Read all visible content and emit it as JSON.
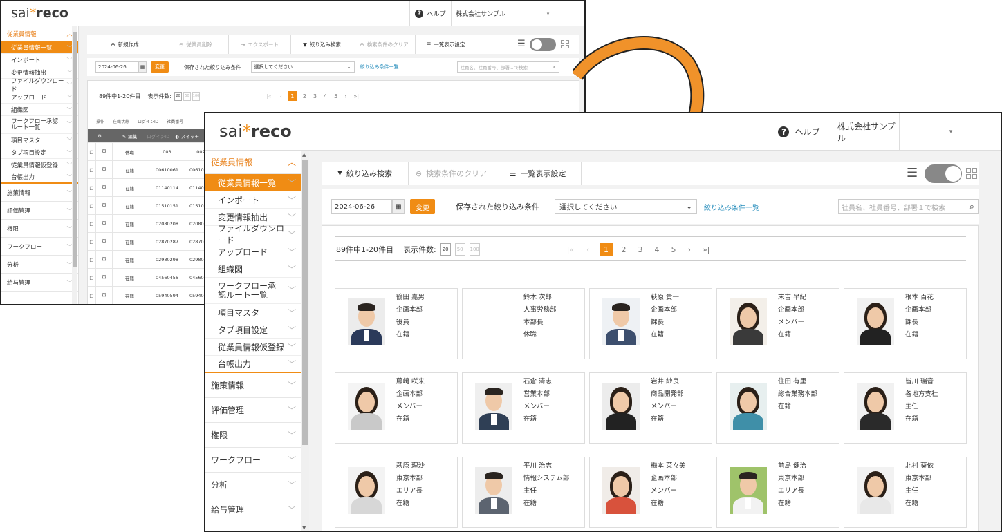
{
  "app": {
    "logo_pre": "sai",
    "logo_star": "*",
    "logo_post": "reco"
  },
  "header": {
    "help": "ヘルプ",
    "company": "株式会社サンプル",
    "user_dropdown": "▾"
  },
  "sidebar": {
    "open_group": "従業員情報",
    "items": [
      "従業員情報一覧",
      "インポート",
      "変更情報抽出",
      "ファイルダウンロード",
      "アップロード",
      "組織図",
      "ワークフロー承認ルート一覧",
      "項目マスタ",
      "タブ項目設定",
      "従業員情報仮登録",
      "台帳出力"
    ],
    "groups": [
      "施策情報",
      "評価管理",
      "権限",
      "ワークフロー",
      "分析",
      "給与管理"
    ]
  },
  "back_toolbar": {
    "new": "新規作成",
    "delete": "従業員削除",
    "export": "エクスポート",
    "filter": "絞り込み検索",
    "clear": "検索条件のクリア",
    "display": "一覧表示設定"
  },
  "front_toolbar": {
    "filter": "絞り込み検索",
    "clear": "検索条件のクリア",
    "display": "一覧表示設定"
  },
  "filter": {
    "date": "2024-06-26",
    "change": "変更",
    "saved_label": "保存された絞り込み条件",
    "select_value": "選択してください",
    "saved_link": "絞り込み条件一覧",
    "search_placeholder": "社員名、社員番号、部署１で検索"
  },
  "pagination": {
    "summary": "89件中1-20件目",
    "size_label": "表示件数:",
    "sizes": [
      "20",
      "50",
      "100"
    ],
    "first": "|«",
    "prev": "‹",
    "pages": [
      "1",
      "2",
      "3",
      "4",
      "5"
    ],
    "next": "›",
    "last": "»|"
  },
  "table": {
    "headers": [
      "操作",
      "在職状態",
      "ログインID",
      "社員番号"
    ],
    "action_edit": "編集",
    "action_switch": "スイッチ",
    "action_col": "ログインID",
    "rows": [
      [
        "休職",
        "003",
        "002"
      ],
      [
        "在籍",
        "00610061",
        "00610061"
      ],
      [
        "在籍",
        "01140114",
        "01140114"
      ],
      [
        "在籍",
        "01510151",
        "01510151"
      ],
      [
        "在籍",
        "02080208",
        "02080208"
      ],
      [
        "在籍",
        "02870287",
        "02870287"
      ],
      [
        "在籍",
        "02980298",
        "02980298"
      ],
      [
        "在籍",
        "04560456",
        "04560456"
      ],
      [
        "在籍",
        "05940594",
        "05940594"
      ]
    ]
  },
  "employees": [
    {
      "name": "鶴田 嘉男",
      "dept": "企画本部",
      "title": "役員",
      "status": "在籍",
      "photo": true,
      "gender": "m",
      "shirt": "#2b3a5a",
      "bg": "#ececec"
    },
    {
      "name": "鈴木 次郎",
      "dept": "人事労務部",
      "title": "本部長",
      "status": "休職",
      "photo": false
    },
    {
      "name": "萩原 貴一",
      "dept": "企画本部",
      "title": "課長",
      "status": "在籍",
      "photo": true,
      "gender": "m",
      "shirt": "#3d4f6e",
      "bg": "#eef1f4"
    },
    {
      "name": "末吉 早紀",
      "dept": "企画本部",
      "title": "メンバー",
      "status": "在籍",
      "photo": true,
      "gender": "f",
      "shirt": "#3a3a3a",
      "bg": "#f3efe9"
    },
    {
      "name": "根本 百花",
      "dept": "企画本部",
      "title": "課長",
      "status": "在籍",
      "photo": true,
      "gender": "f",
      "shirt": "#222222",
      "bg": "#f1f1f1"
    },
    {
      "name": "藤崎 咲来",
      "dept": "企画本部",
      "title": "メンバー",
      "status": "在籍",
      "photo": true,
      "gender": "f",
      "shirt": "#c9c9c9",
      "bg": "#f4f4f4"
    },
    {
      "name": "石倉 清志",
      "dept": "営業本部",
      "title": "メンバー",
      "status": "在籍",
      "photo": true,
      "gender": "m",
      "shirt": "#2f3f55",
      "bg": "#efefef"
    },
    {
      "name": "岩井 紗良",
      "dept": "商品開発部",
      "title": "メンバー",
      "status": "在籍",
      "photo": true,
      "gender": "f",
      "shirt": "#222222",
      "bg": "#ececec"
    },
    {
      "name": "住田 有里",
      "dept": "総合業務本部",
      "title": "在籍",
      "status": "",
      "photo": true,
      "gender": "f",
      "shirt": "#3f8fa8",
      "bg": "#e7efef"
    },
    {
      "name": "皆川 瑞音",
      "dept": "各地方支社",
      "title": "主任",
      "status": "在籍",
      "photo": true,
      "gender": "f",
      "shirt": "#2a2a2a",
      "bg": "#f1f1f1"
    },
    {
      "name": "萩原 理沙",
      "dept": "東京本部",
      "title": "エリア長",
      "status": "在籍",
      "photo": true,
      "gender": "f",
      "shirt": "#d7d7d7",
      "bg": "#f3f3f3"
    },
    {
      "name": "平川 治志",
      "dept": "情報システム部",
      "title": "主任",
      "status": "在籍",
      "photo": true,
      "gender": "m",
      "shirt": "#5c6470",
      "bg": "#ededed"
    },
    {
      "name": "梅本 菜々美",
      "dept": "企画本部",
      "title": "メンバー",
      "status": "在籍",
      "photo": true,
      "gender": "f",
      "shirt": "#d8523c",
      "bg": "#f0ece8"
    },
    {
      "name": "前島 健治",
      "dept": "東京本部",
      "title": "エリア長",
      "status": "在籍",
      "photo": true,
      "gender": "m",
      "shirt": "#f2f2f2",
      "bg": "#9fc36a"
    },
    {
      "name": "北村 葵依",
      "dept": "東京本部",
      "title": "主任",
      "status": "在籍",
      "photo": true,
      "gender": "f",
      "shirt": "#e8e8e8",
      "bg": "#f2f2f2"
    }
  ],
  "colors": {
    "accent": "#f08c14",
    "link": "#2a8fbd",
    "arrow": "#f0922a"
  }
}
